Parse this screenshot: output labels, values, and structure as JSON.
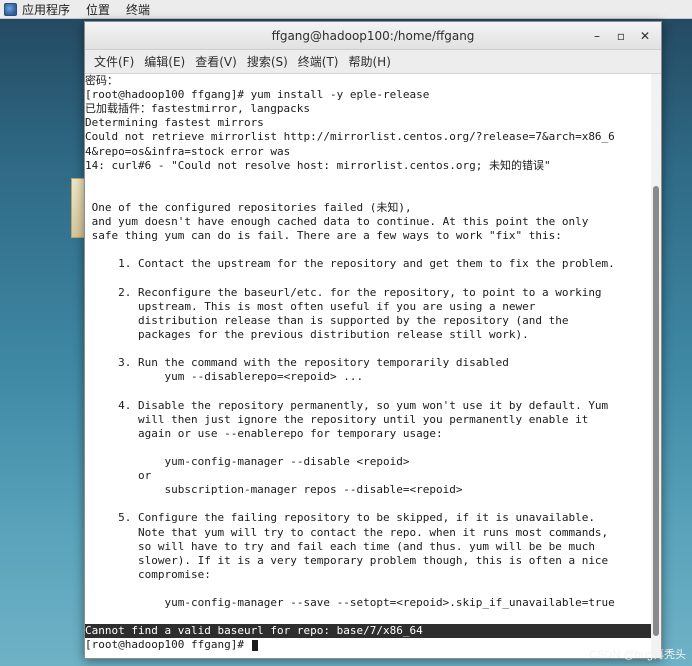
{
  "topbar": {
    "applications": "应用程序",
    "places": "位置",
    "terminal": "终端"
  },
  "window": {
    "title": "ffgang@hadoop100:/home/ffgang",
    "minimize": "–",
    "maximize": "▫",
    "close": "✕"
  },
  "menubar": [
    "文件(F)",
    "编辑(E)",
    "查看(V)",
    "搜索(S)",
    "终端(T)",
    "帮助(H)"
  ],
  "terminal": {
    "lines": [
      "密码：",
      "[root@hadoop100 ffgang]# yum install -y eple-release",
      "已加载插件：fastestmirror, langpacks",
      "Determining fastest mirrors",
      "Could not retrieve mirrorlist http://mirrorlist.centos.org/?release=7&arch=x86_6",
      "4&repo=os&infra=stock error was",
      "14: curl#6 - \"Could not resolve host: mirrorlist.centos.org; 未知的错误\"",
      "",
      "",
      " One of the configured repositories failed (未知),",
      " and yum doesn't have enough cached data to continue. At this point the only",
      " safe thing yum can do is fail. There are a few ways to work \"fix\" this:",
      "",
      "     1. Contact the upstream for the repository and get them to fix the problem.",
      "",
      "     2. Reconfigure the baseurl/etc. for the repository, to point to a working",
      "        upstream. This is most often useful if you are using a newer",
      "        distribution release than is supported by the repository (and the",
      "        packages for the previous distribution release still work).",
      "",
      "     3. Run the command with the repository temporarily disabled",
      "            yum --disablerepo=<repoid> ...",
      "",
      "     4. Disable the repository permanently, so yum won't use it by default. Yum",
      "        will then just ignore the repository until you permanently enable it",
      "        again or use --enablerepo for temporary usage:",
      "",
      "            yum-config-manager --disable <repoid>",
      "        or",
      "            subscription-manager repos --disable=<repoid>",
      "",
      "     5. Configure the failing repository to be skipped, if it is unavailable.",
      "        Note that yum will try to contact the repo. when it runs most commands,",
      "        so will have to try and fail each time (and thus. yum will be be much",
      "        slower). If it is a very temporary problem though, this is often a nice",
      "        compromise:",
      "",
      "            yum-config-manager --save --setopt=<repoid>.skip_if_unavailable=true",
      "",
      "Cannot find a valid baseurl for repo: base/7/x86_64",
      "[root@hadoop100 ffgang]# "
    ]
  },
  "watermark": "CSDN @bug再秃头"
}
